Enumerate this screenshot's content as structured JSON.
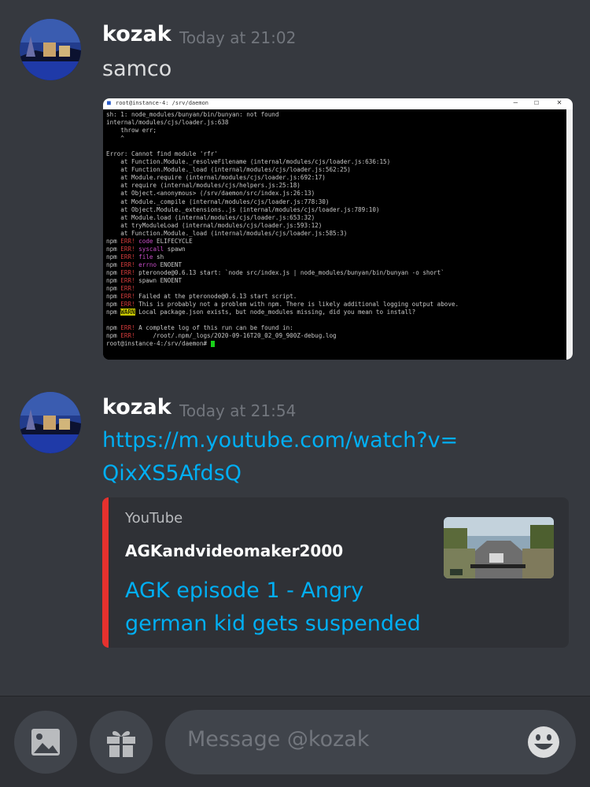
{
  "messages": [
    {
      "author": "kozak",
      "timestamp": "Today at 21:02",
      "text": "samco",
      "attachment": {
        "window_title": "root@instance-4: /srv/daemon",
        "terminal_lines": [
          [
            {
              "t": "sh: 1: node_modules/bunyan/bin/bunyan: not found",
              "c": ""
            }
          ],
          [
            {
              "t": "internal/modules/cjs/loader.js:638",
              "c": ""
            }
          ],
          [
            {
              "t": "    throw err;",
              "c": ""
            }
          ],
          [
            {
              "t": "    ^",
              "c": ""
            }
          ],
          [
            {
              "t": "",
              "c": ""
            }
          ],
          [
            {
              "t": "Error: Cannot find module 'rfr'",
              "c": ""
            }
          ],
          [
            {
              "t": "    at Function.Module._resolveFilename (internal/modules/cjs/loader.js:636:15)",
              "c": ""
            }
          ],
          [
            {
              "t": "    at Function.Module._load (internal/modules/cjs/loader.js:562:25)",
              "c": ""
            }
          ],
          [
            {
              "t": "    at Module.require (internal/modules/cjs/loader.js:692:17)",
              "c": ""
            }
          ],
          [
            {
              "t": "    at require (internal/modules/cjs/helpers.js:25:18)",
              "c": ""
            }
          ],
          [
            {
              "t": "    at Object.<anonymous> (/srv/daemon/src/index.js:26:13)",
              "c": ""
            }
          ],
          [
            {
              "t": "    at Module._compile (internal/modules/cjs/loader.js:778:30)",
              "c": ""
            }
          ],
          [
            {
              "t": "    at Object.Module._extensions..js (internal/modules/cjs/loader.js:789:10)",
              "c": ""
            }
          ],
          [
            {
              "t": "    at Module.load (internal/modules/cjs/loader.js:653:32)",
              "c": ""
            }
          ],
          [
            {
              "t": "    at tryModuleLoad (internal/modules/cjs/loader.js:593:12)",
              "c": ""
            }
          ],
          [
            {
              "t": "    at Function.Module._load (internal/modules/cjs/loader.js:585:3)",
              "c": ""
            }
          ],
          [
            {
              "t": "npm ",
              "c": ""
            },
            {
              "t": "ERR!",
              "c": "red"
            },
            {
              "t": " ",
              "c": ""
            },
            {
              "t": "code",
              "c": "mag"
            },
            {
              "t": " ELIFECYCLE",
              "c": ""
            }
          ],
          [
            {
              "t": "npm ",
              "c": ""
            },
            {
              "t": "ERR!",
              "c": "red"
            },
            {
              "t": " ",
              "c": ""
            },
            {
              "t": "syscall",
              "c": "mag"
            },
            {
              "t": " spawn",
              "c": ""
            }
          ],
          [
            {
              "t": "npm ",
              "c": ""
            },
            {
              "t": "ERR!",
              "c": "red"
            },
            {
              "t": " ",
              "c": ""
            },
            {
              "t": "file",
              "c": "mag"
            },
            {
              "t": " sh",
              "c": ""
            }
          ],
          [
            {
              "t": "npm ",
              "c": ""
            },
            {
              "t": "ERR!",
              "c": "red"
            },
            {
              "t": " ",
              "c": ""
            },
            {
              "t": "errno",
              "c": "mag"
            },
            {
              "t": " ENOENT",
              "c": ""
            }
          ],
          [
            {
              "t": "npm ",
              "c": ""
            },
            {
              "t": "ERR!",
              "c": "red"
            },
            {
              "t": " pteronode@0.6.13 start: `node src/index.js | node_modules/bunyan/bin/bunyan -o short`",
              "c": ""
            }
          ],
          [
            {
              "t": "npm ",
              "c": ""
            },
            {
              "t": "ERR!",
              "c": "red"
            },
            {
              "t": " spawn ENOENT",
              "c": ""
            }
          ],
          [
            {
              "t": "npm ",
              "c": ""
            },
            {
              "t": "ERR!",
              "c": "red"
            }
          ],
          [
            {
              "t": "npm ",
              "c": ""
            },
            {
              "t": "ERR!",
              "c": "red"
            },
            {
              "t": " Failed at the pteronode@0.6.13 start script.",
              "c": ""
            }
          ],
          [
            {
              "t": "npm ",
              "c": ""
            },
            {
              "t": "ERR!",
              "c": "red"
            },
            {
              "t": " This is probably not a problem with npm. There is likely additional logging output above.",
              "c": ""
            }
          ],
          [
            {
              "t": "npm ",
              "c": ""
            },
            {
              "t": "WARN",
              "c": "warn"
            },
            {
              "t": " Local package.json exists, but node_modules missing, did you mean to install?",
              "c": ""
            }
          ],
          [
            {
              "t": "",
              "c": ""
            }
          ],
          [
            {
              "t": "npm ",
              "c": ""
            },
            {
              "t": "ERR!",
              "c": "red"
            },
            {
              "t": " A complete log of this run can be found in:",
              "c": ""
            }
          ],
          [
            {
              "t": "npm ",
              "c": ""
            },
            {
              "t": "ERR!",
              "c": "red"
            },
            {
              "t": "     /root/.npm/_logs/2020-09-16T20_02_09_900Z-debug.log",
              "c": ""
            }
          ],
          [
            {
              "t": "root@instance-4:/srv/daemon# ",
              "c": ""
            },
            {
              "t": "",
              "c": "cursor"
            }
          ]
        ]
      }
    },
    {
      "author": "kozak",
      "timestamp": "Today at 21:54",
      "link": "https://m.youtube.com/watch?v=QixXS5AfdsQ",
      "embed": {
        "provider": "YouTube",
        "author": "AGKandvideomaker2000",
        "title": "AGK episode 1 - Angry german kid gets suspended",
        "accent_color": "#e5312e"
      }
    }
  ],
  "composer": {
    "placeholder": "Message @kozak",
    "image_button_icon": "image-icon",
    "gift_button_icon": "gift-icon",
    "emoji_button_icon": "emoji-icon"
  },
  "colors": {
    "background": "#36393f",
    "link": "#00aff4",
    "muted": "#72767d"
  }
}
